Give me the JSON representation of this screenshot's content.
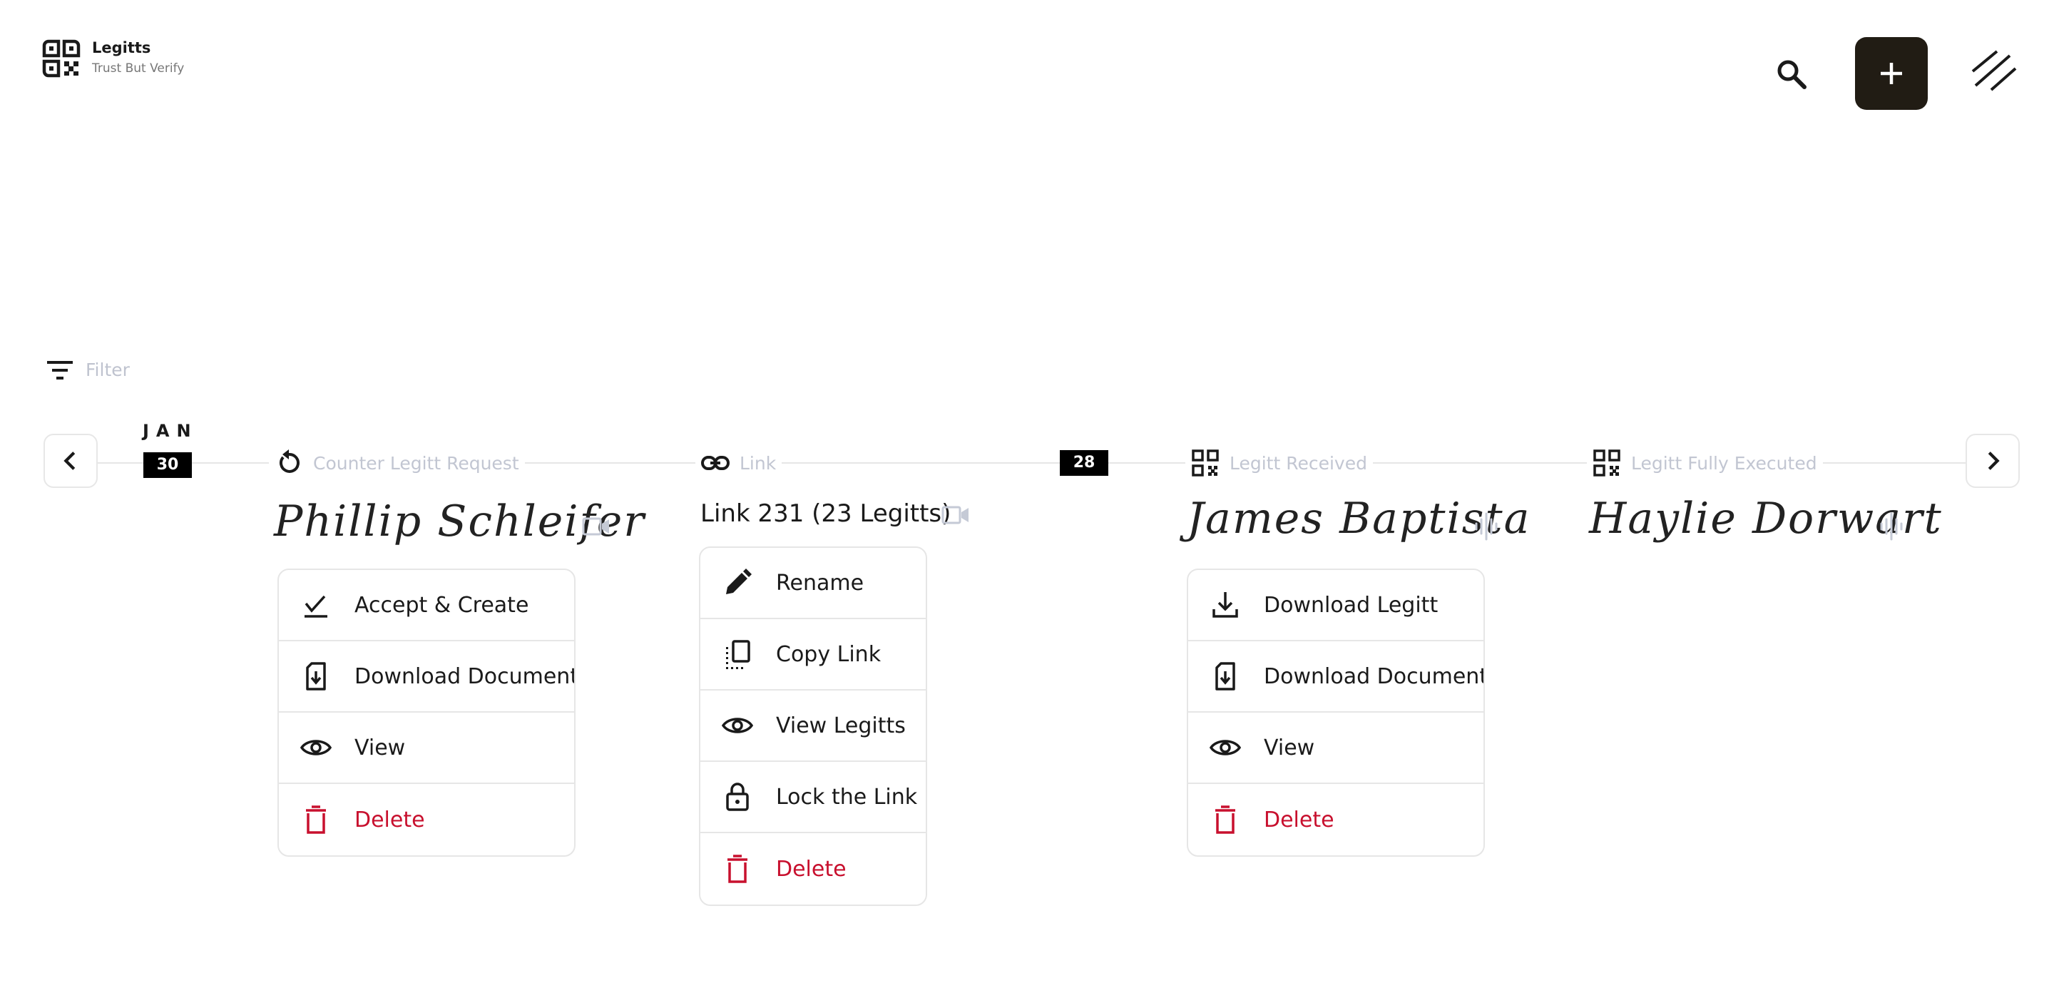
{
  "brand": {
    "name": "Legitts",
    "tagline": "Trust But Verify"
  },
  "header": {
    "search_icon": "search-icon",
    "add_icon": "plus-icon",
    "menu_icon": "menu-lines-icon"
  },
  "filter": {
    "label": "Filter"
  },
  "timeline": {
    "month": "JAN",
    "dates": [
      "30",
      "28"
    ],
    "stages": [
      {
        "icon": "refresh-icon",
        "label": "Counter Legitt Request"
      },
      {
        "icon": "link-icon",
        "label": "Link"
      },
      {
        "icon": "qr-icon",
        "label": "Legitt Received"
      },
      {
        "icon": "qr-icon",
        "label": "Legitt Fully Executed"
      }
    ]
  },
  "cards": [
    {
      "name": "Phillip Schleifer",
      "media_icon": "video-icon",
      "menu": [
        {
          "label": "Accept & Create",
          "icon": "check-icon"
        },
        {
          "label": "Download Document",
          "icon": "file-download-icon"
        },
        {
          "label": "View",
          "icon": "eye-icon"
        },
        {
          "label": "Delete",
          "icon": "trash-icon",
          "danger": true
        }
      ]
    },
    {
      "name": "Link 231 (23 Legitts)",
      "media_icon": "video-icon",
      "menu": [
        {
          "label": "Rename",
          "icon": "pencil-icon"
        },
        {
          "label": "Copy Link",
          "icon": "copy-icon"
        },
        {
          "label": "View Legitts",
          "icon": "eye-icon"
        },
        {
          "label": "Lock the Link",
          "icon": "lock-icon"
        },
        {
          "label": "Delete",
          "icon": "trash-icon",
          "danger": true
        }
      ]
    },
    {
      "name": "James Baptista",
      "media_icon": "audio-wave-icon",
      "menu": [
        {
          "label": "Download Legitt",
          "icon": "download-icon"
        },
        {
          "label": "Download Document",
          "icon": "file-download-icon"
        },
        {
          "label": "View",
          "icon": "eye-icon"
        },
        {
          "label": "Delete",
          "icon": "trash-icon",
          "danger": true
        }
      ]
    },
    {
      "name": "Haylie Dorwart",
      "media_icon": "audio-wave-icon"
    }
  ],
  "colors": {
    "danger": "#c8102e",
    "add_button": "#211c14",
    "muted": "#c2c6d2"
  }
}
